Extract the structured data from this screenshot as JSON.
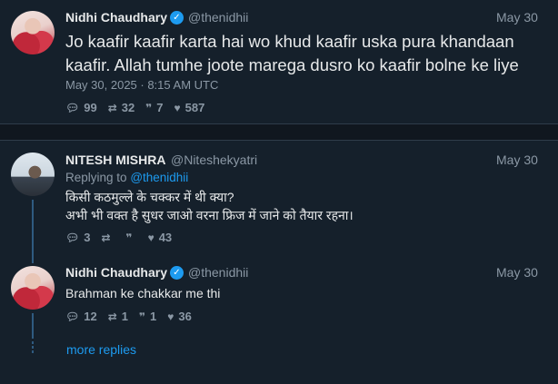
{
  "main_tweet": {
    "author": "Nidhi Chaudhary",
    "handle": "@thenidhii",
    "date": "May 30",
    "text_line1": "Jo kaafir kaafir karta hai wo khud kaafir uska pura khandaan",
    "text_line2": "kaafir. Allah tumhe joote marega dusro ko kaafir bolne ke liye",
    "timestamp": "May 30, 2025 · 8:15 AM UTC",
    "replies": "99",
    "retweets": "32",
    "quotes": "7",
    "likes": "587"
  },
  "reply1": {
    "author": "NITESH MISHRA",
    "handle": "@Niteshekyatri",
    "date": "May 30",
    "replying_prefix": "Replying to",
    "replying_to": "@thenidhii",
    "text_line1": "किसी कठमुल्ले के चक्कर में थी क्या?",
    "text_line2": "अभी भी वक्त है सुधर जाओ वरना फ्रिज में जाने को तैयार रहना।",
    "replies": "3",
    "retweets": "",
    "quotes": "",
    "likes": "43"
  },
  "reply2": {
    "author": "Nidhi Chaudhary",
    "handle": "@thenidhii",
    "date": "May 30",
    "text": "Brahman ke chakkar me thi",
    "replies": "12",
    "retweets": "1",
    "quotes": "1",
    "likes": "36"
  },
  "more_replies": "more replies",
  "icons": {
    "reply": "speech-bubble-icon",
    "retweet": "retweet-icon",
    "quote": "quote-icon",
    "like": "heart-icon",
    "verified": "verified-badge-icon"
  },
  "colors": {
    "background": "#15202b",
    "accent": "#1d9bf0",
    "muted": "#8b98a5"
  }
}
